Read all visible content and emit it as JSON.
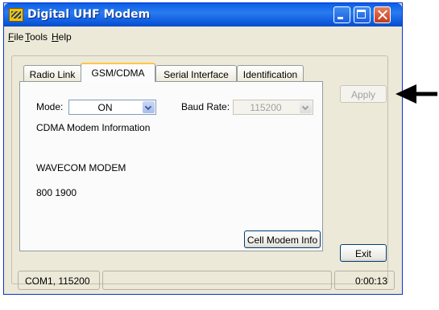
{
  "window": {
    "title": "Digital UHF Modem"
  },
  "menu": {
    "file": "File",
    "tools": "Tools",
    "help": "Help"
  },
  "tabs": [
    {
      "label": "Radio Link"
    },
    {
      "label": "GSM/CDMA"
    },
    {
      "label": "Serial Interface"
    },
    {
      "label": "Identification"
    }
  ],
  "gsm": {
    "mode_label": "Mode:",
    "mode_value": "ON",
    "baud_label": "Baud Rate:",
    "baud_value": "115200",
    "info_heading": "CDMA Modem Information",
    "modem_name": "WAVECOM MODEM",
    "bands": "800 1900",
    "cell_info_button": "Cell Modem Info"
  },
  "buttons": {
    "apply": "Apply",
    "exit": "Exit"
  },
  "status": {
    "port": "COM1, 115200",
    "message": "",
    "time": "0:00:13"
  },
  "icons": [
    "app-icon",
    "minimize-icon",
    "maximize-icon",
    "close-icon",
    "chevron-down-icon"
  ]
}
